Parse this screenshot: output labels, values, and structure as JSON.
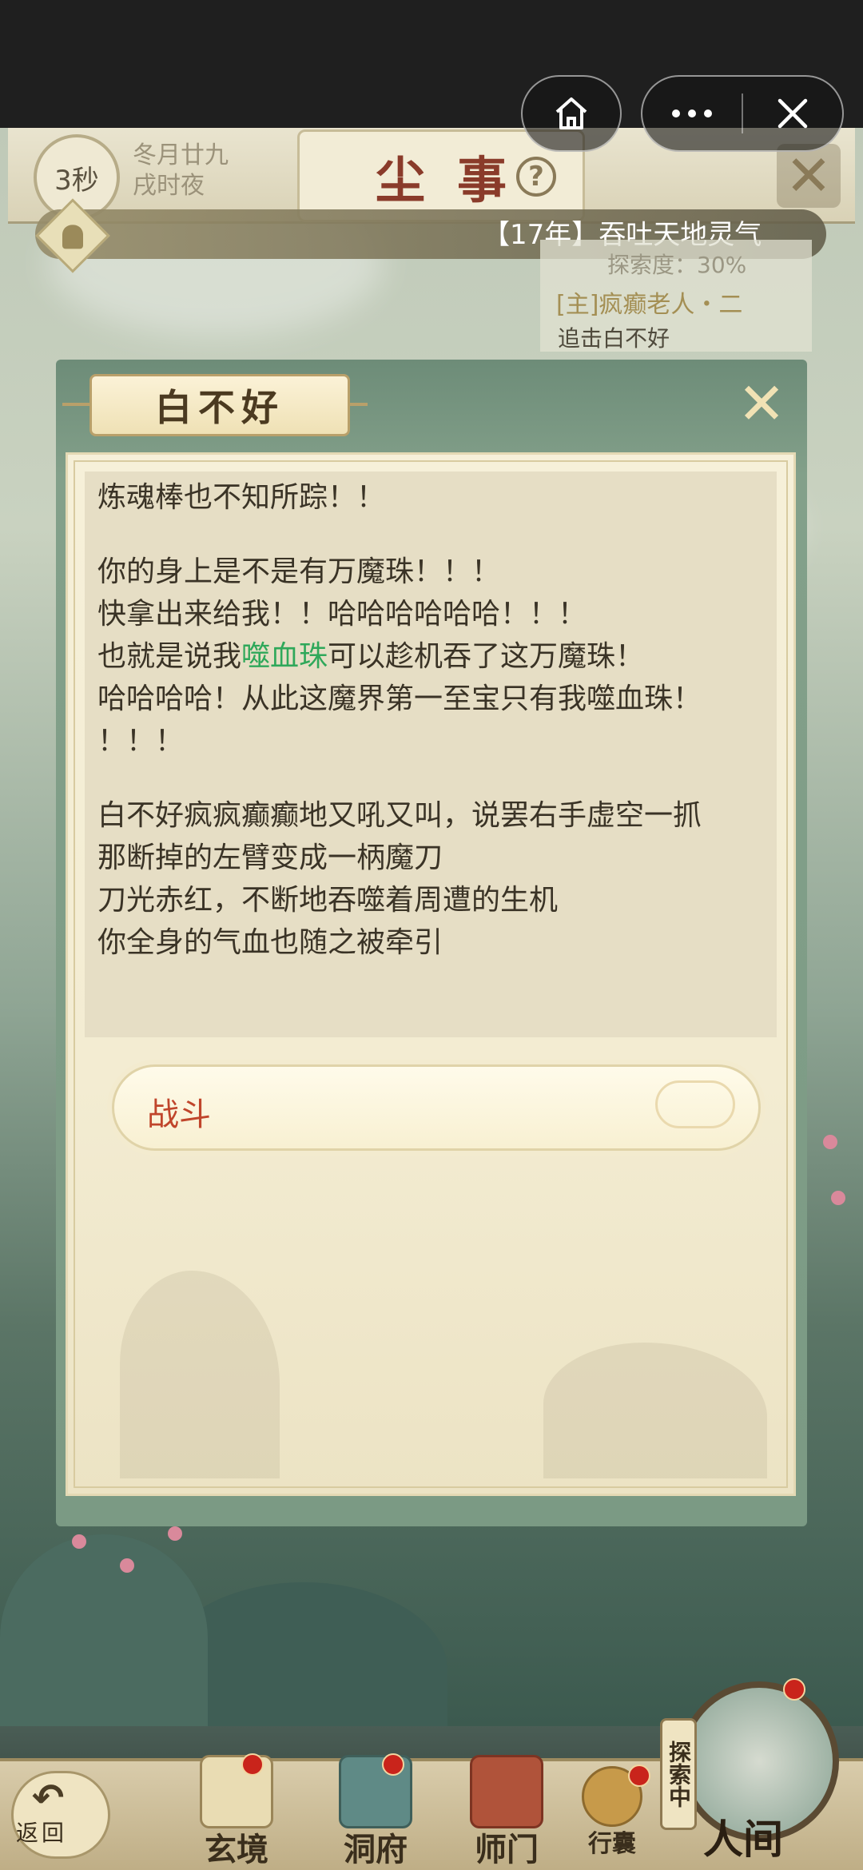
{
  "capsule": {
    "home_icon": "home-icon",
    "more_icon": "more-dots-icon",
    "close_icon": "close-icon"
  },
  "header": {
    "timer": "3秒",
    "date_line1": "冬月廿九",
    "date_line2": "戌时夜",
    "title_char1": "尘",
    "title_char2": "事",
    "help": "?",
    "collapse": "✕"
  },
  "notice": {
    "text": "【17年】吞吐天地灵气"
  },
  "quest": {
    "explore": "探索度：30%",
    "title": "[主]疯癫老人・二",
    "desc": "追击白不好"
  },
  "dialog": {
    "title": "白不好",
    "close": "✕",
    "lines": [
      "炼魂棒也不知所踪！！",
      "",
      "你的身上是不是有万魔珠！！！",
      "快拿出来给我！！哈哈哈哈哈哈！！！",
      "也就是说我|噬血珠|可以趁机吞了这万魔珠！",
      "哈哈哈哈！从此这魔界第一至宝只有我噬血珠！",
      "！！！",
      "",
      "白不好疯疯癫癫地又吼又叫，说罢右手虚空一抓",
      "那断掉的左臂变成一柄魔刀",
      "刀光赤红，不断地吞噬着周遭的生机",
      "你全身的气血也随之被牵引"
    ],
    "line_4_pre": "也就是说我",
    "line_4_hl": "噬血珠",
    "line_4_post": "可以趁机吞了这万魔珠！",
    "option": "战斗",
    "highlight_color": "#2fa85a"
  },
  "nav": {
    "back": "返回",
    "items": [
      {
        "label": "玄境",
        "icon": "scroll-icon"
      },
      {
        "label": "洞府",
        "icon": "pavilion-icon"
      },
      {
        "label": "师门",
        "icon": "banner-icon"
      },
      {
        "label": "行囊",
        "icon": "bag-icon"
      }
    ],
    "explore_tag": "探索中",
    "world": "人间"
  }
}
